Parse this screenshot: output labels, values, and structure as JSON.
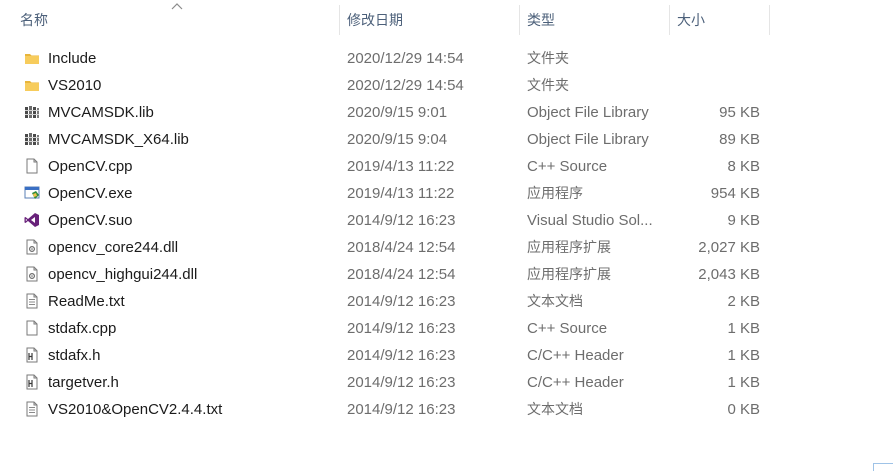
{
  "header": {
    "name": "名称",
    "date": "修改日期",
    "type": "类型",
    "size": "大小"
  },
  "files": [
    {
      "name": "Include",
      "date": "2020/12/29 14:54",
      "type": "文件夹",
      "size": "",
      "icon": "folder-icon"
    },
    {
      "name": "VS2010",
      "date": "2020/12/29 14:54",
      "type": "文件夹",
      "size": "",
      "icon": "folder-icon"
    },
    {
      "name": "MVCAMSDK.lib",
      "date": "2020/9/15 9:01",
      "type": "Object File Library",
      "size": "95 KB",
      "icon": "library-icon"
    },
    {
      "name": "MVCAMSDK_X64.lib",
      "date": "2020/9/15 9:04",
      "type": "Object File Library",
      "size": "89 KB",
      "icon": "library-icon"
    },
    {
      "name": "OpenCV.cpp",
      "date": "2019/4/13 11:22",
      "type": "C++ Source",
      "size": "8 KB",
      "icon": "cpp-file-icon"
    },
    {
      "name": "OpenCV.exe",
      "date": "2019/4/13 11:22",
      "type": "应用程序",
      "size": "954 KB",
      "icon": "application-icon"
    },
    {
      "name": "OpenCV.suo",
      "date": "2014/9/12 16:23",
      "type": "Visual Studio Sol...",
      "size": "9 KB",
      "icon": "visual-studio-icon"
    },
    {
      "name": "opencv_core244.dll",
      "date": "2018/4/24 12:54",
      "type": "应用程序扩展",
      "size": "2,027 KB",
      "icon": "dll-file-icon"
    },
    {
      "name": "opencv_highgui244.dll",
      "date": "2018/4/24 12:54",
      "type": "应用程序扩展",
      "size": "2,043 KB",
      "icon": "dll-file-icon"
    },
    {
      "name": "ReadMe.txt",
      "date": "2014/9/12 16:23",
      "type": "文本文档",
      "size": "2 KB",
      "icon": "text-file-icon"
    },
    {
      "name": "stdafx.cpp",
      "date": "2014/9/12 16:23",
      "type": "C++ Source",
      "size": "1 KB",
      "icon": "cpp-file-icon"
    },
    {
      "name": "stdafx.h",
      "date": "2014/9/12 16:23",
      "type": "C/C++ Header",
      "size": "1 KB",
      "icon": "header-file-icon"
    },
    {
      "name": "targetver.h",
      "date": "2014/9/12 16:23",
      "type": "C/C++ Header",
      "size": "1 KB",
      "icon": "header-file-icon"
    },
    {
      "name": "VS2010&OpenCV2.4.4.txt",
      "date": "2014/9/12 16:23",
      "type": "文本文档",
      "size": "0 KB",
      "icon": "text-file-icon"
    }
  ],
  "colors": {
    "header_text": "#4c607a",
    "folder": "#f2c65b",
    "detail_text": "#6d6d6d",
    "vs_purple": "#68217a"
  }
}
